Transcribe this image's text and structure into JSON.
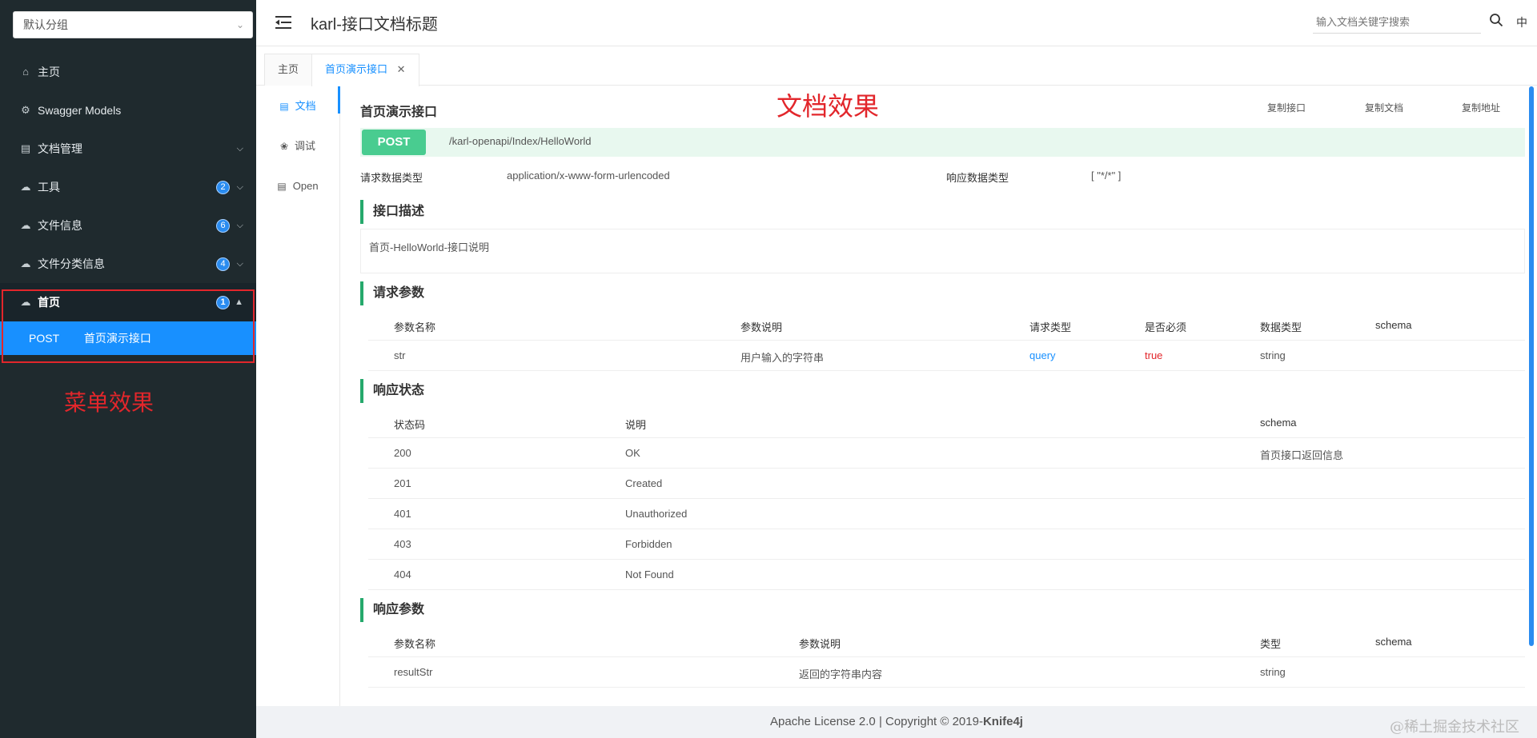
{
  "sidebar": {
    "group_select": "默认分组",
    "items": [
      {
        "label": "主页",
        "icon": "home-icon"
      },
      {
        "label": "Swagger Models",
        "icon": "gear-icon"
      },
      {
        "label": "文档管理",
        "icon": "document-icon"
      },
      {
        "label": "工具",
        "icon": "cloud-icon",
        "badge": "2"
      },
      {
        "label": "文件信息",
        "icon": "cloud-icon",
        "badge": "6"
      },
      {
        "label": "文件分类信息",
        "icon": "cloud-icon",
        "badge": "4"
      },
      {
        "label": "首页",
        "icon": "cloud-icon",
        "badge": "1"
      }
    ],
    "subitem": {
      "method": "POST",
      "label": "首页演示接口"
    },
    "caption": "菜单效果"
  },
  "header": {
    "title": "karl-接口文档标题",
    "search_placeholder": "输入文档关键字搜索",
    "lang": "中"
  },
  "tabs": [
    {
      "label": "主页"
    },
    {
      "label": "首页演示接口"
    }
  ],
  "subtabs": [
    {
      "label": "文档"
    },
    {
      "label": "调试"
    },
    {
      "label": "Open"
    }
  ],
  "doc": {
    "title": "首页演示接口",
    "caption": "文档效果",
    "copy_api": "复制接口",
    "copy_doc": "复制文档",
    "copy_url": "复制地址",
    "method": "POST",
    "path": "/karl-openapi/Index/HelloWorld",
    "req_type_label": "请求数据类型",
    "req_type_value": "application/x-www-form-urlencoded",
    "resp_type_label": "响应数据类型",
    "resp_type_value": "[ \"*/*\" ]",
    "desc_title": "接口描述",
    "desc_text": "首页-HelloWorld-接口说明",
    "req_params_title": "请求参数",
    "req_params_headers": [
      "参数名称",
      "参数说明",
      "请求类型",
      "是否必须",
      "数据类型",
      "schema"
    ],
    "req_params_rows": [
      [
        "str",
        "用户输入的字符串",
        "query",
        "true",
        "string",
        ""
      ]
    ],
    "resp_status_title": "响应状态",
    "resp_status_headers": [
      "状态码",
      "说明",
      "schema"
    ],
    "resp_status_rows": [
      [
        "200",
        "OK",
        "首页接口返回信息"
      ],
      [
        "201",
        "Created",
        ""
      ],
      [
        "401",
        "Unauthorized",
        ""
      ],
      [
        "403",
        "Forbidden",
        ""
      ],
      [
        "404",
        "Not Found",
        ""
      ]
    ],
    "resp_params_title": "响应参数",
    "resp_params_headers": [
      "参数名称",
      "参数说明",
      "类型",
      "schema"
    ],
    "resp_params_rows": [
      [
        "resultStr",
        "返回的字符串内容",
        "string",
        ""
      ]
    ]
  },
  "footer": {
    "text": "Apache License 2.0 | Copyright © 2019-",
    "brand": "Knife4j",
    "watermark": "@稀土掘金技术社区"
  },
  "colors": {
    "sidebar_bg": "#1f2a2e",
    "accent": "#1890ff",
    "post_green": "#49cc90",
    "section_bar": "#26a96c",
    "annotation_red": "#e2262b"
  }
}
